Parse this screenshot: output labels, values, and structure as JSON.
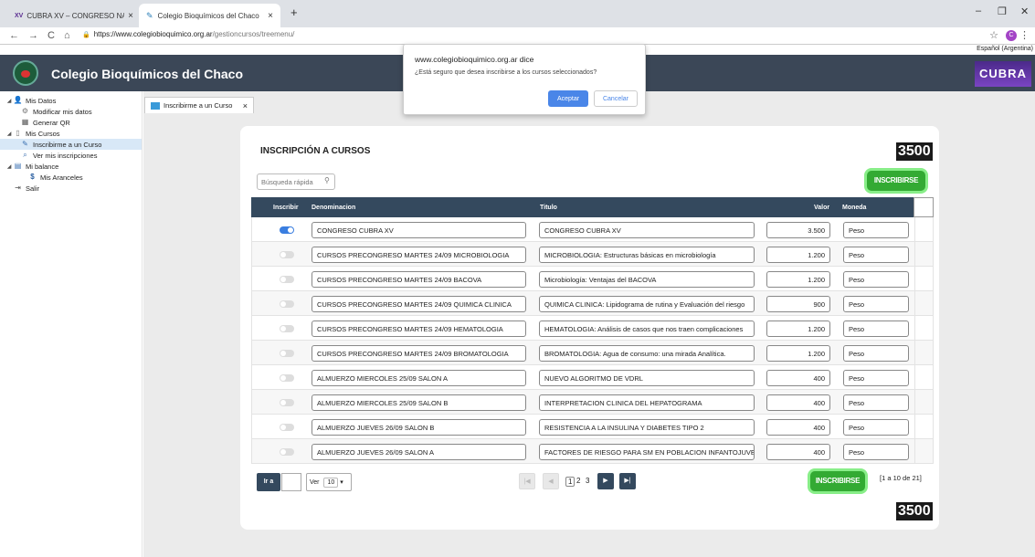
{
  "browser": {
    "tabs": [
      {
        "label": "CUBRA XV – CONGRESO NACIO",
        "favicon": "XV"
      },
      {
        "label": "Colegio Bioquímicos del Chaco",
        "favicon": "cb-logo"
      }
    ],
    "url_host": "https://www.colegiobioquimico.org.ar",
    "url_path": "/gestioncursos/treemenu/",
    "profile_initial": "C",
    "language": "Español (Argentina)"
  },
  "dialog": {
    "title": "www.colegiobioquimico.org.ar dice",
    "message": "¿Está seguro que desea inscribirse a los cursos seleccionados?",
    "ok_label": "Aceptar",
    "cancel_label": "Cancelar"
  },
  "header": {
    "title": "Colegio Bioquímicos del Chaco",
    "right_logo": "CUBRA XV"
  },
  "sidebar": {
    "items": [
      {
        "label": "Mis Datos",
        "level": 0,
        "icon": "user-icon"
      },
      {
        "label": "Modificar mis datos",
        "level": 1,
        "icon": "gear-icon"
      },
      {
        "label": "Generar QR",
        "level": 1,
        "icon": "qr-icon"
      },
      {
        "label": "Mis Cursos",
        "level": 0,
        "icon": "document-icon"
      },
      {
        "label": "Inscribirme a un Curso",
        "level": 1,
        "icon": "pen-icon",
        "selected": true
      },
      {
        "label": "Ver mis inscripciones",
        "level": 1,
        "icon": "magnifier-icon"
      },
      {
        "label": "Mi balance",
        "level": 0,
        "icon": "chart-icon"
      },
      {
        "label": "Mis Aranceles",
        "level": 1,
        "icon": "dollar-icon"
      },
      {
        "label": "Salir",
        "level": 0,
        "icon": "exit-icon"
      }
    ]
  },
  "content_tab": {
    "label": "Inscribirme a un Curso"
  },
  "page": {
    "title": "INSCRIPCIÓN A CURSOS",
    "total": "3500",
    "search_placeholder": "Búsqueda rápida",
    "inscribir_label": "INSCRIBIRSE",
    "columns": {
      "inscribir": "Inscribir",
      "denominacion": "Denominacion",
      "titulo": "Titulo",
      "valor": "Valor",
      "moneda": "Moneda"
    },
    "rows": [
      {
        "checked": true,
        "denominacion": "CONGRESO CUBRA XV",
        "titulo": "CONGRESO CUBRA XV",
        "valor": "3.500",
        "moneda": "Peso"
      },
      {
        "checked": false,
        "denominacion": "CURSOS PRECONGRESO MARTES 24/09 MICROBIOLOGIA",
        "titulo": "MICROBIOLOGIA: Estructuras básicas en microbiología",
        "valor": "1.200",
        "moneda": "Peso"
      },
      {
        "checked": false,
        "denominacion": "CURSOS PRECONGRESO MARTES 24/09 BACOVA",
        "titulo": "Microbiología: Ventajas del BACOVA",
        "valor": "1.200",
        "moneda": "Peso"
      },
      {
        "checked": false,
        "denominacion": "CURSOS PRECONGRESO MARTES 24/09 QUIMICA CLINICA",
        "titulo": "QUIMICA CLINICA: Lipidograma de rutina y Evaluación del riesgo",
        "valor": "900",
        "moneda": "Peso"
      },
      {
        "checked": false,
        "denominacion": "CURSOS PRECONGRESO MARTES 24/09 HEMATOLOGIA",
        "titulo": "HEMATOLOGIA: Análisis de casos que nos traen complicaciones",
        "valor": "1.200",
        "moneda": "Peso"
      },
      {
        "checked": false,
        "denominacion": "CURSOS PRECONGRESO MARTES 24/09 BROMATOLOGIA",
        "titulo": "BROMATOLOGIA: Agua de consumo: una mirada Analítica.",
        "valor": "1.200",
        "moneda": "Peso"
      },
      {
        "checked": false,
        "denominacion": "ALMUERZO MIERCOLES 25/09 SALON A",
        "titulo": "NUEVO ALGORITMO DE VDRL",
        "valor": "400",
        "moneda": "Peso"
      },
      {
        "checked": false,
        "denominacion": "ALMUERZO MIERCOLES 25/09 SALON B",
        "titulo": "INTERPRETACION CLINICA DEL HEPATOGRAMA",
        "valor": "400",
        "moneda": "Peso"
      },
      {
        "checked": false,
        "denominacion": "ALMUERZO JUEVES 26/09 SALON B",
        "titulo": "RESISTENCIA A LA INSULINA Y DIABETES TIPO 2",
        "valor": "400",
        "moneda": "Peso"
      },
      {
        "checked": false,
        "denominacion": "ALMUERZO JUEVES 26/09 SALON A",
        "titulo": "FACTORES DE RIESGO PARA SM EN POBLACION INFANTOJUVENIL",
        "valor": "400",
        "moneda": "Peso"
      }
    ],
    "pager": {
      "ir_label": "Ir a",
      "ver_label": "Ver",
      "page_size": "10",
      "pages": [
        "1",
        "2",
        "3"
      ],
      "current_page": "1",
      "info": "[1 a 10 de 21]"
    }
  }
}
